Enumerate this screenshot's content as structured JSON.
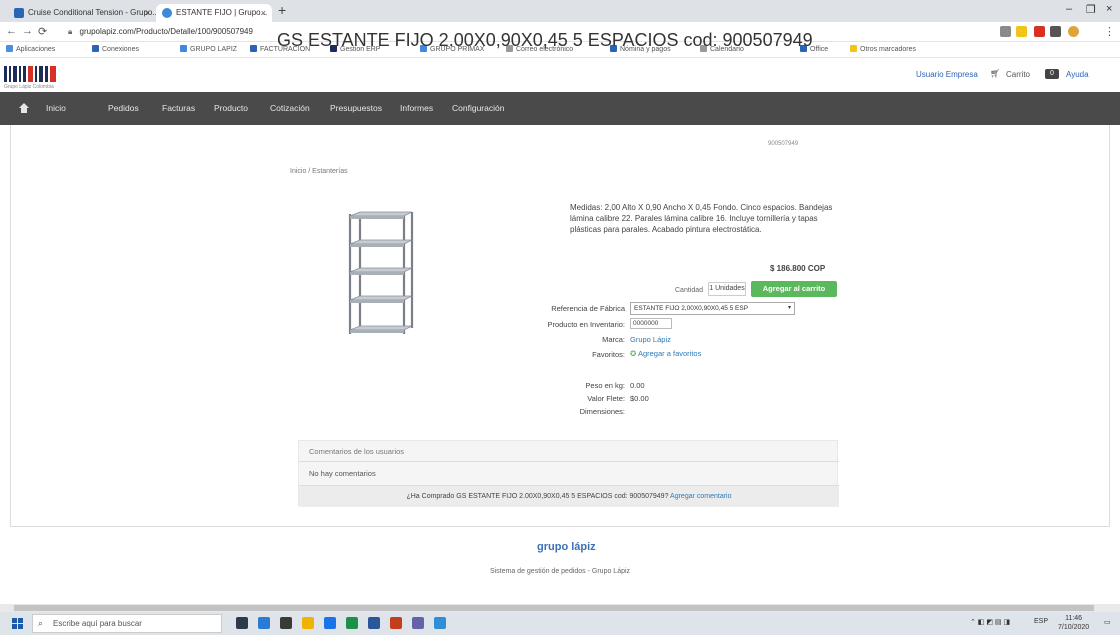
{
  "browser": {
    "tabs": [
      {
        "label": "Cruise Conditional Tension - Grupo...",
        "fav_color": "#2b63b5"
      },
      {
        "label": "ESTANTE FIJO | Grupo...",
        "fav_color": "#3c8ad9"
      }
    ],
    "url": "grupolapiz.com/Producto/Detalle/100/900507949",
    "bookmarks": [
      "Aplicaciones",
      "Conexiones",
      "GRUPO LAPIZ",
      "FACTURACION",
      "Gestion ERP",
      "GRUPO PRIMAX",
      "Correo electrónico",
      "Nómina y pagos",
      "Calendario",
      "Office",
      "Otros marcadores"
    ]
  },
  "site": {
    "logo_sub": "Grupo Lápiz Colombia",
    "user_menu": "Usuario Empresa",
    "cart_label": "Carrito",
    "cart_count": "0",
    "extra_link": "Ayuda",
    "nav": [
      "Inicio",
      "Pedidos",
      "Facturas",
      "Producto",
      "Cotización",
      "Presupuestos",
      "Informes",
      "Configuración"
    ]
  },
  "product": {
    "title": "GS ESTANTE FIJO 2.00X0,90X0,45 5 ESPACIOS cod: 900507949",
    "small_tag": "900507949",
    "breadcrumb": "Inicio / Estanterías",
    "description": "Medidas: 2,00 Alto X 0,90 Ancho X 0,45 Fondo. Cinco espacios. Bandejas lámina calibre 22. Parales lámina calibre 16. Incluye tornillería y tapas plásticas para parales. Acabado pintura electrostática.",
    "price": "$ 186.800 COP",
    "qty_label": "Cantidad",
    "qty_value": "1 Unidades",
    "add_button": "Agregar al carrito",
    "rows": [
      {
        "label": "Referencia de Fábrica",
        "value": "ESTANTE FIJO 2,00X0,90X0,45 5 ESP"
      },
      {
        "label": "Producto en Inventario:",
        "value": "0000000"
      },
      {
        "label": "Marca:",
        "value": "Grupo Lápiz"
      },
      {
        "label": "Favoritos:",
        "value": "Agregar a favoritos"
      }
    ],
    "details": [
      {
        "label": "Peso en kg:",
        "value": "0.00"
      },
      {
        "label": "Valor Flete:",
        "value": "$0.00"
      },
      {
        "label": "Dimensiones:",
        "value": ""
      }
    ]
  },
  "comments": {
    "header": "Comentarios de los usuarios",
    "body": "No hay comentarios",
    "footer_text": "¿Ha Comprado GS ESTANTE FIJO 2.00X0,90X0,45 5 ESPACIOS cod: 900507949?",
    "footer_link": "Agregar comentario"
  },
  "footer": {
    "logo": "grupo lápiz",
    "text": "Sistema de gestión de pedidos - Grupo Lápiz"
  },
  "taskbar": {
    "search_placeholder": "Escribe aquí para buscar",
    "time": "11:46",
    "date": "7/10/2020",
    "lang": "ESP"
  }
}
